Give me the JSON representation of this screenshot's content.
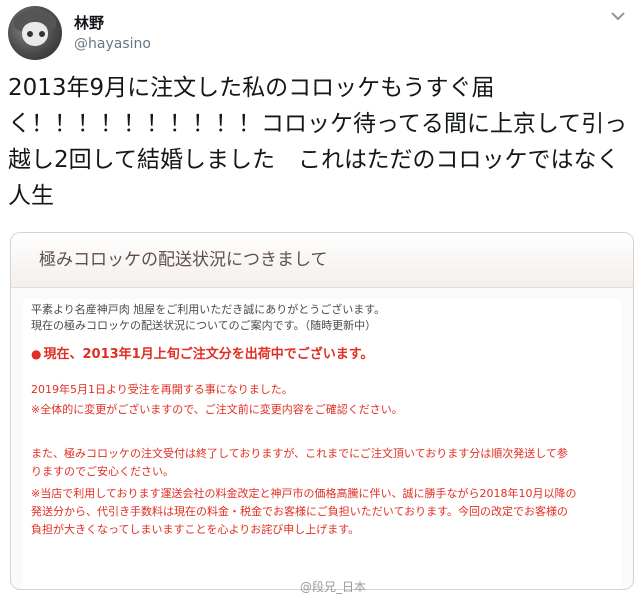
{
  "tweet": {
    "display_name": "林野",
    "handle": "@hayasino",
    "text": "2013年9月に注文した私のコロッケもうすぐ届く！！！！！！！！！！コロッケ待ってる間に上京して引っ越し2回して結婚しました　これはただのコロッケではなく人生",
    "more_icon": "chevron-down-icon"
  },
  "card": {
    "title": "極みコロッケの配送状況につきまして",
    "intro_lines": [
      "平素より名産神戸肉 旭屋をご利用いただき誠にありがとうございます。",
      "現在の極みコロッケの配送状況についてのご案内です。（随時更新中）"
    ],
    "highlight": "現在、2013年1月上旬ご注文分を出荷中でございます。",
    "highlight_bullet": "●",
    "notice_lines": [
      "2019年5月1日より受注を再開する事になりました。",
      "※全体的に変更がございますので、ご注文前に変更内容をご確認ください。"
    ],
    "detail_lines": [
      "また、極みコロッケの注文受付は終了しておりますが、これまでにご注文頂いております分は順次発送して参",
      "りますのでご安心ください。",
      "※当店で利用しております運送会社の料金改定と神戸市の価格高騰に伴い、誠に勝手ながら2018年10月以降の",
      "発送分から、代引き手数料は現在の料金・税金でお客様にご負担いただいております。今回の改定でお客様の",
      "負担が大きくなってしまいますことを心よりお詫び申し上げます。"
    ]
  },
  "watermark": "@段兄_日本",
  "colors": {
    "text": "#14171a",
    "handle": "#657786",
    "alert_red": "#e12e22",
    "card_title": "#5e5048"
  }
}
